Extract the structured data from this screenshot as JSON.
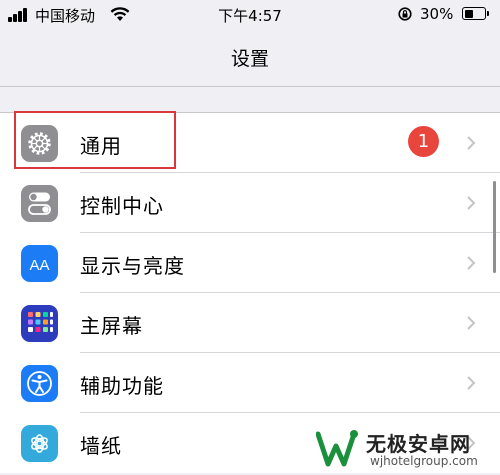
{
  "status_bar": {
    "carrier": "中国移动",
    "time": "下午4:57",
    "battery_percent": "30%",
    "battery_level": 0.3,
    "icons": [
      "signal-icon",
      "wifi-icon",
      "orientation-lock-icon",
      "battery-icon"
    ]
  },
  "nav": {
    "title": "设置"
  },
  "settings": {
    "items": [
      {
        "label": "通用",
        "icon": "gear-icon",
        "badge": "1",
        "highlighted": true
      },
      {
        "label": "控制中心",
        "icon": "control-center-icon"
      },
      {
        "label": "显示与亮度",
        "icon": "display-brightness-icon"
      },
      {
        "label": "主屏幕",
        "icon": "home-screen-icon"
      },
      {
        "label": "辅助功能",
        "icon": "accessibility-icon"
      },
      {
        "label": "墙纸",
        "icon": "wallpaper-icon"
      }
    ]
  },
  "icon_colors": {
    "general": "#8e8e93",
    "control_center": "#8e8e93",
    "display": "#1b7cf5",
    "home_screen": "#2c3cbd",
    "accessibility": "#1b7cf5",
    "wallpaper": "#34aadc"
  },
  "badge_color": "#e8453c",
  "highlight_color": "#d9363e",
  "watermark": {
    "brand": "无极安卓网",
    "url": "wjhotelgroup.com"
  }
}
